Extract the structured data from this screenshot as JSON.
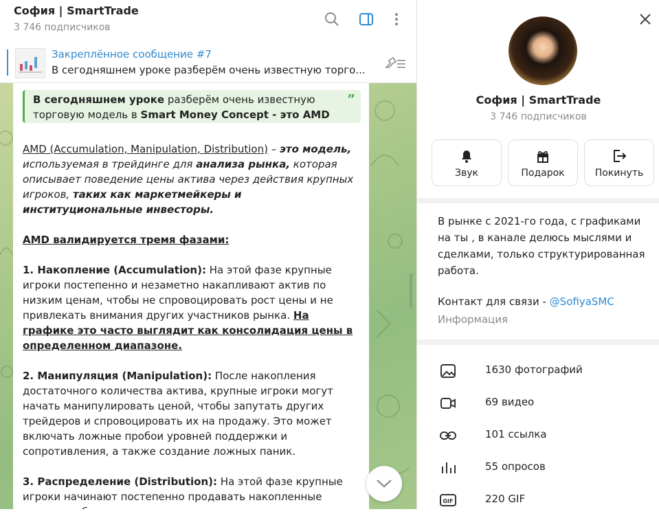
{
  "header": {
    "title": "София | SmartTrade",
    "subscribers": "3 746 подписчиков"
  },
  "pinned": {
    "title": "Закреплённое сообщение #7",
    "text": "В сегодняшнем уроке разберём очень известную торго..."
  },
  "message": {
    "quote": {
      "part1": "В сегодняшнем уроке",
      "part2": " разберём очень известную торговую модель в ",
      "part3": "Smart Money Concept - это AMD",
      "mark": "”"
    },
    "intro": {
      "term": "AMD (Accumulation, Manipulation, Distribution)",
      "t1": " – ",
      "t2": "это модель,",
      "t3": " используемая в трейдинге для ",
      "t4": "анализа рынка,",
      "t5": " которая описывает поведение цены актива через действия крупных игроков, ",
      "t6": "таких как маркетмейкеры и институциональные инвесторы."
    },
    "phases_heading": "AMD валидируется тремя фазами:",
    "phase1": {
      "title": "1. Накопление (Accumulation):",
      "text": " На этой фазе крупные игроки постепенно и незаметно накапливают актив по низким ценам, чтобы не спровоцировать рост цены и не привлекать внимания других участников рынка. ",
      "highlight": "На графике это часто выглядит как консолидация цены в определенном диапазоне."
    },
    "phase2": {
      "title": "2. Манипуляция (Manipulation):",
      "text": " После накопления достаточного количества актива, крупные игроки могут начать манипулировать ценой, чтобы запутать других трейдеров и спровоцировать их на продажу. Это может включать ложные пробои уровней поддержки и сопротивления, а также создание ложных паник."
    },
    "phase3": {
      "title": "3. Распределение (Distribution):",
      "text": " На этой фазе крупные игроки начинают постепенно продавать накопленные активы по более высоким ценам."
    }
  },
  "profile": {
    "name": "София | SmartTrade",
    "subscribers": "3 746 подписчиков",
    "actions": [
      {
        "label": "Звук",
        "icon": "bell-icon"
      },
      {
        "label": "Подарок",
        "icon": "gift-icon"
      },
      {
        "label": "Покинуть",
        "icon": "leave-icon"
      }
    ],
    "about": "В рынке с 2021-го года, с графиками на ты , в канале делюсь мыслями и сделками, только структурированная работа.",
    "contact_prefix": "Контакт для связи - ",
    "contact_link": "@SofiyaSMC",
    "info_label": "Информация",
    "media": [
      {
        "label": "1630 фотографий",
        "icon": "photo-icon"
      },
      {
        "label": "69 видео",
        "icon": "video-icon"
      },
      {
        "label": "101 ссылка",
        "icon": "link-icon"
      },
      {
        "label": "55 опросов",
        "icon": "poll-icon"
      },
      {
        "label": "220 GIF",
        "icon": "gif-icon"
      }
    ]
  },
  "colors": {
    "accent": "#2f8ad0",
    "quote_green": "#4fae4e",
    "chat_bg": "#a9c889"
  }
}
